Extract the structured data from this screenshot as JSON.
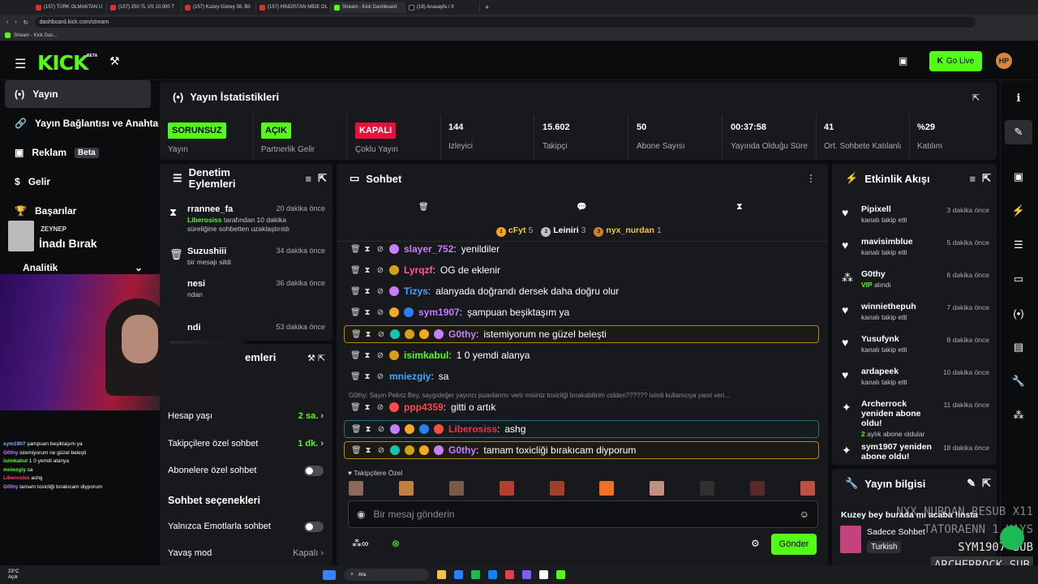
{
  "browser": {
    "tabs": [
      "(157) TÜRK OLMAKTAN U",
      "(157) 250 TL VS 10.000 T",
      "(157) Kuzey Güney 38. Bö",
      "(157) HİNDİSTAN MİDE OL",
      "Stream - Kick Dashboard",
      "(18) Anasayfa / X"
    ],
    "url": "dashboard.kick.com/stream",
    "bookmark": "Stream - Kick Das..."
  },
  "header": {
    "logo": "KICK",
    "beta": "BETA",
    "go_live": "Go Live"
  },
  "nav": {
    "items": [
      "Yayın",
      "Yayın Bağlantısı ve Anahta",
      "Reklam",
      "Gelir",
      "Başarılar",
      "Analitik"
    ],
    "reklam_badge": "Beta"
  },
  "overlay_top": {
    "name": "ZEYNEP",
    "title": "İnadı Bırak"
  },
  "stats": {
    "title": "Yayın İstatistikleri",
    "items": [
      {
        "value": "SORUNSUZ",
        "label": "Yayın",
        "pill": "g"
      },
      {
        "value": "AÇIK",
        "label": "Partnerlik Gelir",
        "pill": "g"
      },
      {
        "value": "KAPALI",
        "label": "Çoklu Yayın",
        "pill": "r"
      },
      {
        "value": "144",
        "label": "İzleyici"
      },
      {
        "value": "15.602",
        "label": "Takipçi"
      },
      {
        "value": "50",
        "label": "Abone Sayısı"
      },
      {
        "value": "00:37:58",
        "label": "Yayında Olduğu Süre"
      },
      {
        "value": "41",
        "label": "Ort. Sohbete Katılanlar"
      },
      {
        "value": "%29",
        "label": "Katılım"
      }
    ]
  },
  "mod": {
    "title": "Denetim Eylemleri",
    "items": [
      {
        "name": "rrannee_fa",
        "time": "20 dakika önce",
        "desc_user": "Liberosiss",
        "desc": "tarafından 10 dakika süreliğine sohbetten uzaklaştırıldı"
      },
      {
        "name": "Suzushiii",
        "time": "34 dakika önce",
        "desc": "bir mesajı sildi"
      },
      {
        "name": "nesi",
        "time": "36 dakika önce",
        "desc": "ndan"
      },
      {
        "name": "ndi",
        "time": "53 dakika önce"
      }
    ]
  },
  "settings": {
    "title": "emleri",
    "hesap_yasi": "Hesap yaşı",
    "hesap_val": "2 sa.",
    "takipci": "Takipçilere özel sohbet",
    "takipci_val": "1 dk.",
    "abone": "Abonelere özel sohbet",
    "options_title": "Sohbet seçenekleri",
    "emote": "Yalnızca Emotlarla sohbet",
    "yavas": "Yavaş mod",
    "yavas_val": "Kapalı"
  },
  "chat": {
    "title": "Sohbet",
    "top": [
      {
        "name": "cFyt",
        "n": "5"
      },
      {
        "name": "Leiniri",
        "n": "3"
      },
      {
        "name": "nyx_nurdan",
        "n": "1"
      }
    ],
    "messages": [
      {
        "user": "slayer_752",
        "text": "yenildiler",
        "color": "#c77dff"
      },
      {
        "user": "Lyrqzf",
        "text": "OG de eklenir",
        "color": "#ff5aa0"
      },
      {
        "user": "Tizys",
        "text": "alanyada doğrandı dersek daha doğru olur",
        "color": "#3fa7ff"
      },
      {
        "user": "sym1907",
        "text": "şampuan beşiktaşım ya",
        "color": "#c77dff"
      },
      {
        "user": "G0thy",
        "text": "istemiyorum ne güzel beleşti",
        "color": "#c77dff"
      },
      {
        "user": "isimkabul",
        "text": "1 0 yemdi alanya",
        "color": "#53fc18"
      },
      {
        "user": "mniezgiy",
        "text": "sa",
        "color": "#3fa7ff"
      },
      {
        "user": "ppp4359",
        "text": "gitti o artık",
        "color": "#ff4a4a"
      },
      {
        "user": "Liberosiss",
        "text": "ashg",
        "color": "#ff2b55"
      },
      {
        "user": "G0thy",
        "text": "tamam toxicliği bırakıcam diyporum",
        "color": "#c77dff"
      }
    ],
    "reply": "G0thy: Sayın Pekriz Bey, saygıdeğer yayıncı puanlarımı verir misiniz toxicliği bırakabilirim cidden?????? isimli kullanıcıya yanıt veri...",
    "followers_label": "Takipçilere Özel",
    "input_placeholder": "Bir mesaj gönderin",
    "send": "Gönder"
  },
  "events": {
    "title": "Etkinlik Akışı",
    "items": [
      {
        "name": "Pipixell",
        "desc": "kanalı takip etti",
        "time": "3 dakika önce"
      },
      {
        "name": "mavisimblue",
        "desc": "kanalı takip etti",
        "time": "5 dakika önce"
      },
      {
        "name": "G0thy",
        "desc_hl": "VIP",
        "desc": "alındı",
        "time": "6 dakika önce"
      },
      {
        "name": "winniethepuh",
        "desc": "kanalı takip etti",
        "time": "7 dakika önce"
      },
      {
        "name": "Yusufynk",
        "desc": "kanalı takip etti",
        "time": "8 dakika önce"
      },
      {
        "name": "ardapeek",
        "desc": "kanalı takip etti",
        "time": "10 dakika önce"
      },
      {
        "name": "Archerrock yeniden abone oldu!",
        "desc_hl": "2",
        "desc": "aylık abone oldular",
        "time": "11 dakika önce"
      },
      {
        "name": "sym1907 yeniden abone oldu!",
        "time": "18 dakika önce"
      }
    ]
  },
  "info": {
    "title": "Yayın bilgisi",
    "stream_title": "Kuzey bey burada mı acaba !insta",
    "category": "Sadece Sohbet",
    "language": "Turkish"
  },
  "overlay_chat": [
    {
      "u": "sym1907",
      "t": "şampuan beşiktaşım ya"
    },
    {
      "u": "G0thy",
      "t": "istemiyorum ne güzel beleşti"
    },
    {
      "u": "isimkabul",
      "t": "1 0 yemdi alanya"
    },
    {
      "u": "mniezgiy",
      "t": "sa"
    },
    {
      "u": "Liberosiss",
      "t": "ashg"
    },
    {
      "u": "G0thy",
      "t": "tamam toxicliği bırakıcam diyporum"
    }
  ],
  "overlay_subs": [
    "NYX_NURDAN RESUB X11",
    "TATORAENN 1 KAYS",
    "SYM1907 SUB",
    "ARCHERROCK SUB"
  ],
  "taskbar": {
    "weather": "23°C",
    "weather_sub": "Açık",
    "search": "Ara"
  }
}
